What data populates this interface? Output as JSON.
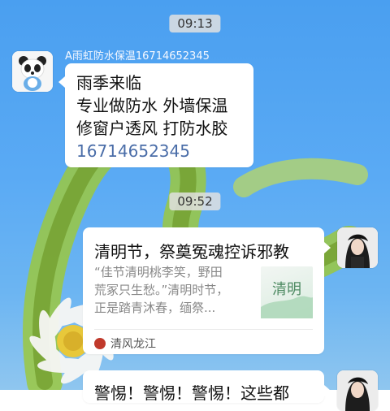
{
  "chat": {
    "time_1": "09:13",
    "time_2": "09:52",
    "message_1": {
      "sender": "A雨虹防水保温16714652345",
      "lines": [
        "雨季来临",
        "专业做防水  外墙保温",
        "修窗户透风  打防水胶",
        "16714652345"
      ]
    },
    "card": {
      "title": "清明节，祭奠冤魂控诉邪教",
      "desc_lines": [
        "“佳节清明桃李笑，野田",
        "荒冢只生愁。”清明时节，",
        "正是踏青沐春，缅祭..."
      ],
      "source": "清风龙江",
      "thumb_text": "清明"
    },
    "card_2": {
      "title_partial": "警惕！警惕！警惕！这些都"
    }
  },
  "colors": {
    "background": "#5aaaf4",
    "bubble": "#ffffff",
    "phone_link": "#4a6da8",
    "time_pill": "#e1e1e1"
  },
  "icons": {
    "sender_avatar": "panda-avatar-icon",
    "self_avatar": "girl-avatar-icon",
    "source": "qingfeng-logo-icon"
  }
}
